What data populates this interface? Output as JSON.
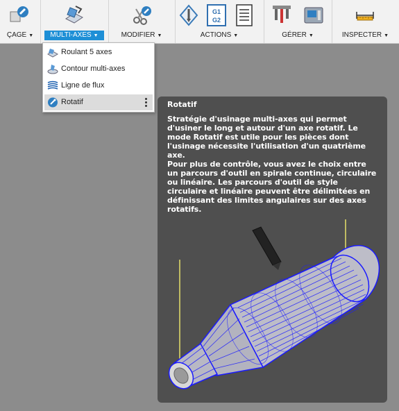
{
  "toolbar": {
    "groups": [
      {
        "label": "ÇAGE"
      },
      {
        "label": "MULTI-AXES"
      },
      {
        "label": "MODIFIER"
      },
      {
        "label": "ACTIONS"
      },
      {
        "label": "GÉRER"
      },
      {
        "label": "INSPECTER"
      }
    ],
    "g1g2_icon_text": [
      "G1",
      "G2"
    ]
  },
  "menu": {
    "items": [
      {
        "label": "Roulant 5 axes",
        "icon": "swarf-icon"
      },
      {
        "label": "Contour multi-axes",
        "icon": "multiaxis-contour-icon"
      },
      {
        "label": "Ligne de flux",
        "icon": "flow-icon"
      },
      {
        "label": "Rotatif",
        "icon": "rotary-icon",
        "selected": true
      }
    ]
  },
  "tooltip": {
    "title": "Rotatif",
    "paragraph1": "Stratégie d'usinage multi-axes qui permet d'usiner le long et autour d'un axe rotatif. Le mode Rotatif est utile pour les pièces dont l'usinage nécessite l'utilisation d'un quatrième axe.",
    "paragraph2": "Pour plus de contrôle, vous avez le choix entre un parcours d'outil en spirale continue, circulaire ou linéaire. Les parcours d'outil de style circulaire et linéaire peuvent être délimitées en définissant des limites angulaires sur des axes rotatifs."
  },
  "colors": {
    "accent": "#1e8fd6",
    "toolpath": "#1a1aff",
    "tooltip_bg": "#4f4f4f",
    "workspace": "#8c8c8c"
  }
}
